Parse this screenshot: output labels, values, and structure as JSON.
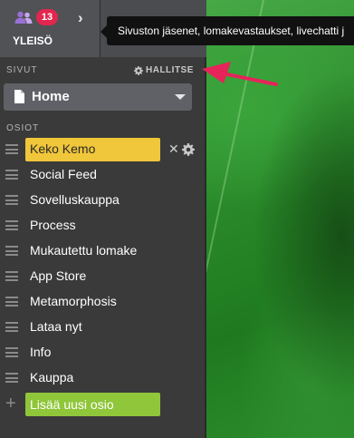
{
  "audience": {
    "badge_count": "13",
    "label": "YLEISÖ"
  },
  "tooltip": {
    "text": "Sivuston jäsenet, lomakevastaukset, livechatti j"
  },
  "pages": {
    "section_label": "SIVUT",
    "manage_label": "HALLITSE",
    "selected_page": "Home"
  },
  "sections": {
    "section_label": "OSIOT",
    "active": {
      "label": "Keko Kemo"
    },
    "items": [
      {
        "label": "Social Feed"
      },
      {
        "label": "Sovelluskauppa"
      },
      {
        "label": "Process"
      },
      {
        "label": "Mukautettu lomake"
      },
      {
        "label": "App Store"
      },
      {
        "label": "Metamorphosis"
      },
      {
        "label": "Lataa nyt"
      },
      {
        "label": "Info"
      },
      {
        "label": "Kauppa"
      }
    ],
    "add_label": "Lisää uusi osio"
  },
  "colors": {
    "panel": "#3a3a3a",
    "active_section": "#f0c63a",
    "add_button": "#8fc63a",
    "badge": "#e2264d",
    "annotation_arrow": "#e6245a"
  },
  "icons": {
    "people": "people-icon",
    "chevron": "chevron-right-icon",
    "gear": "gear-icon",
    "document": "document-icon",
    "close": "close-icon",
    "drag": "drag-handle-icon",
    "plus": "plus-icon"
  }
}
